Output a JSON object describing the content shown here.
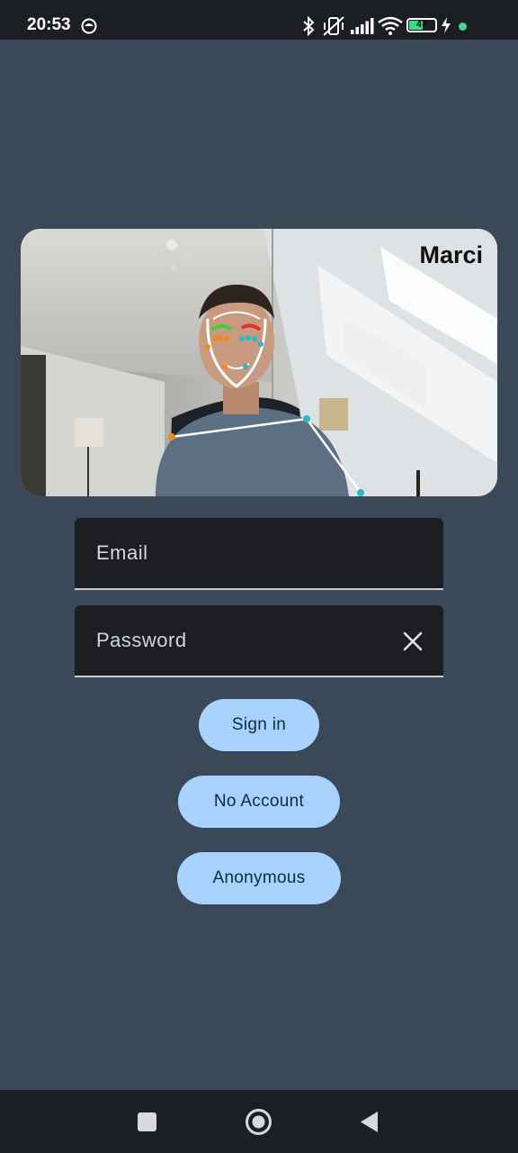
{
  "status": {
    "time": "20:53",
    "battery": "47",
    "icons": [
      "notification-app-icon",
      "bluetooth-icon",
      "vibrate-icon",
      "signal-icon",
      "wifi-icon",
      "battery-icon",
      "charging-icon",
      "mic-active-dot-icon"
    ],
    "accent": "#3ddc84"
  },
  "camera": {
    "user_name": "Marci",
    "landmark_colors": {
      "outline": "#ffffff",
      "left_brow": "#3ad13a",
      "right_brow": "#e03030",
      "point_a": "#27b8c9",
      "point_b": "#ee8a21"
    }
  },
  "form": {
    "email_placeholder": "Email",
    "email_value": "",
    "password_placeholder": "Password",
    "password_value": ""
  },
  "buttons": {
    "sign_in": "Sign in",
    "no_account": "No Account",
    "anonymous": "Anonymous"
  },
  "nav": {
    "icons": [
      "recents-square-icon",
      "home-circle-icon",
      "back-triangle-icon"
    ]
  }
}
